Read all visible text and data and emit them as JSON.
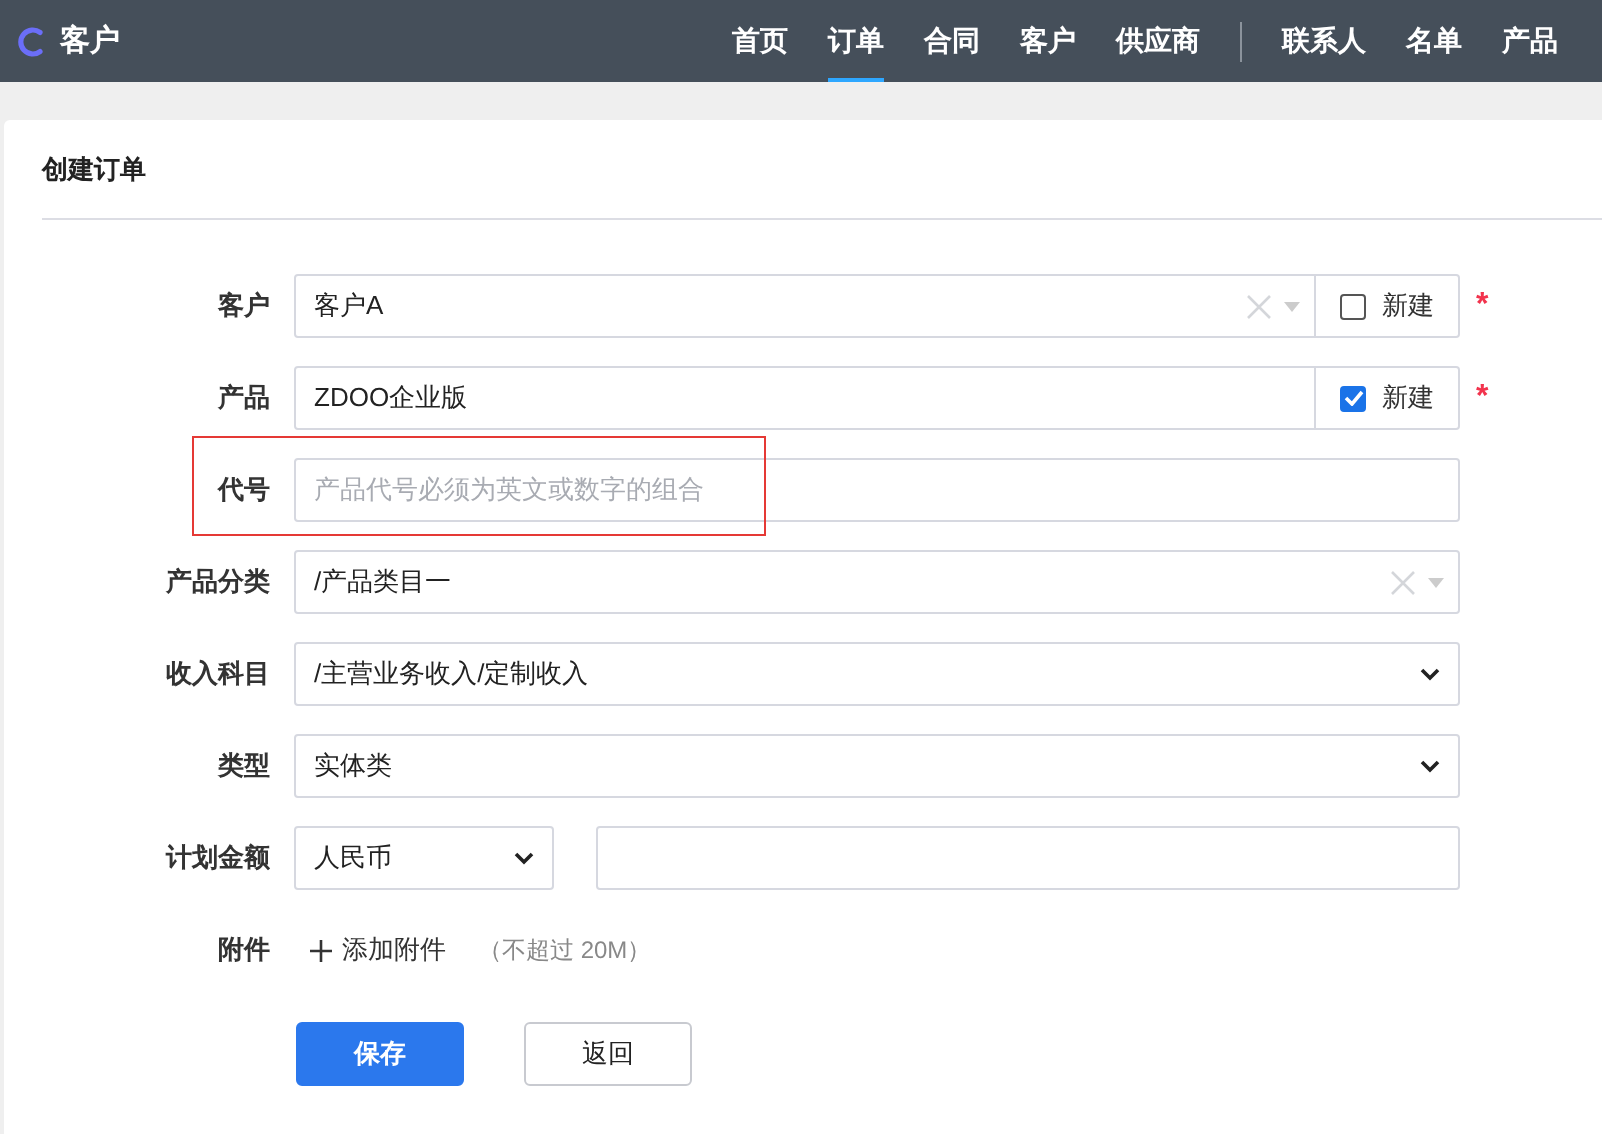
{
  "header": {
    "brand": "客户",
    "nav_groups": [
      [
        {
          "label": "首页",
          "selected": false
        },
        {
          "label": "订单",
          "selected": true
        },
        {
          "label": "合同",
          "selected": false
        },
        {
          "label": "客户",
          "selected": false
        },
        {
          "label": "供应商",
          "selected": false
        }
      ],
      [
        {
          "label": "联系人",
          "selected": false
        },
        {
          "label": "名单",
          "selected": false
        },
        {
          "label": "产品",
          "selected": false
        }
      ]
    ]
  },
  "card": {
    "title": "创建订单"
  },
  "fields": [
    {
      "kind": "combo",
      "label": "客户",
      "value": "客户A",
      "clearable": true,
      "new_option": {
        "label": "新建",
        "checked": false
      },
      "required_mark": "*",
      "highlighted": false
    },
    {
      "kind": "text",
      "label": "产品",
      "value": "ZDOO企业版",
      "new_option": {
        "label": "新建",
        "checked": true
      },
      "required_mark": "*",
      "highlighted": false
    },
    {
      "kind": "text",
      "label": "代号",
      "placeholder": "产品代号必须为英文或数字的组合",
      "highlighted": true
    },
    {
      "kind": "combo",
      "label": "产品分类",
      "value": "/产品类目一",
      "clearable": true,
      "highlighted": false
    },
    {
      "kind": "select",
      "label": "收入科目",
      "value": "/主营业务收入/定制收入",
      "highlighted": false
    },
    {
      "kind": "select",
      "label": "类型",
      "value": "实体类",
      "highlighted": false
    },
    {
      "kind": "money",
      "label": "计划金额",
      "currency": "人民币",
      "highlighted": false
    },
    {
      "kind": "attachment",
      "label": "附件",
      "action": "添加附件",
      "hint": "（不超过 20M）",
      "highlighted": false
    }
  ],
  "buttons": [
    {
      "kind": "primary",
      "label": "保存"
    },
    {
      "kind": "secondary",
      "label": "返回"
    }
  ]
}
